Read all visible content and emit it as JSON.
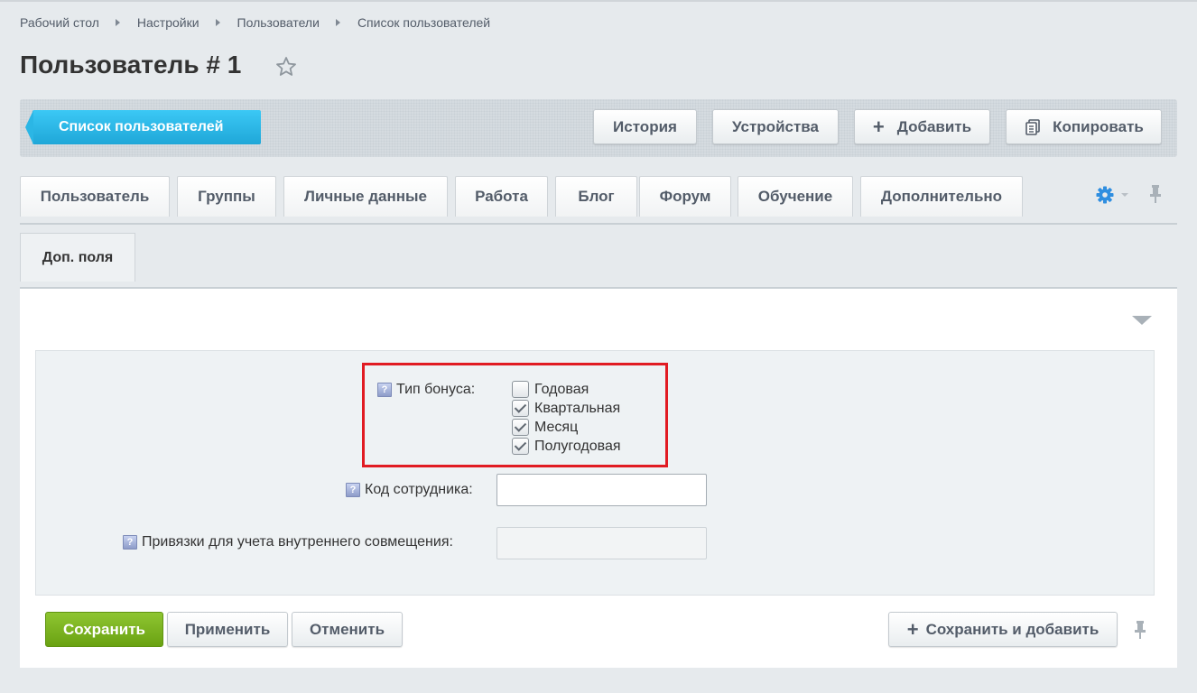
{
  "breadcrumb": [
    "Рабочий стол",
    "Настройки",
    "Пользователи",
    "Список пользователей"
  ],
  "page": {
    "title": "Пользователь # 1"
  },
  "toolbar": {
    "back_label": "Список пользователей",
    "history_label": "История",
    "devices_label": "Устройства",
    "add_label": "Добавить",
    "copy_label": "Копировать"
  },
  "tabs": [
    "Пользователь",
    "Группы",
    "Личные данные",
    "Работа",
    "Блог",
    "Форум",
    "Обучение",
    "Дополнительно"
  ],
  "subtab": "Доп. поля",
  "fields": {
    "bonus_type": {
      "label": "Тип бонуса:",
      "options": [
        {
          "label": "Годовая",
          "checked": false
        },
        {
          "label": "Квартальная",
          "checked": true
        },
        {
          "label": "Месяц",
          "checked": true
        },
        {
          "label": "Полугодовая",
          "checked": true
        }
      ]
    },
    "employee_code": {
      "label": "Код сотрудника:",
      "value": ""
    },
    "bindings": {
      "label": "Привязки для учета внутреннего совмещения:",
      "value": ""
    }
  },
  "help_glyph": "?",
  "plus_glyph": "+",
  "buttons": {
    "save": "Сохранить",
    "apply": "Применить",
    "cancel": "Отменить",
    "save_add": "Сохранить и добавить"
  },
  "colors": {
    "accent": "#2fc6f6",
    "save": "#7bb31a",
    "highlight": "#e11b22"
  }
}
